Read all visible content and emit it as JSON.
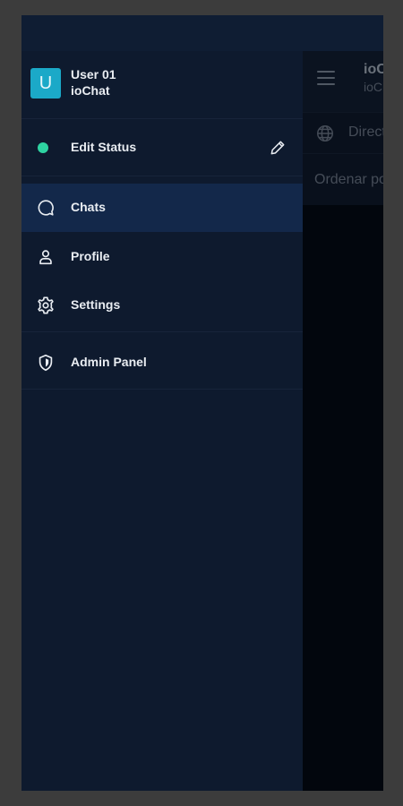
{
  "main": {
    "title": "ioChat",
    "subtitle": "ioChat",
    "directory_label": "Directory",
    "sort_label": "Ordenar por"
  },
  "drawer": {
    "user": {
      "avatar_letter": "U",
      "name": "User 01",
      "app": "ioChat",
      "avatar_color": "#1ba9c8"
    },
    "status": {
      "label": "Edit Status",
      "dot_color": "#2ed3a2"
    },
    "nav": [
      {
        "label": "Chats",
        "icon": "chat-bubble-icon",
        "active": true
      },
      {
        "label": "Profile",
        "icon": "person-icon",
        "active": false
      },
      {
        "label": "Settings",
        "icon": "gear-icon",
        "active": false
      }
    ],
    "admin": {
      "label": "Admin Panel",
      "icon": "shield-icon"
    }
  },
  "colors": {
    "drawer_bg": "#0e1a2e",
    "active_bg": "#13284a",
    "text": "#e9edf2"
  }
}
